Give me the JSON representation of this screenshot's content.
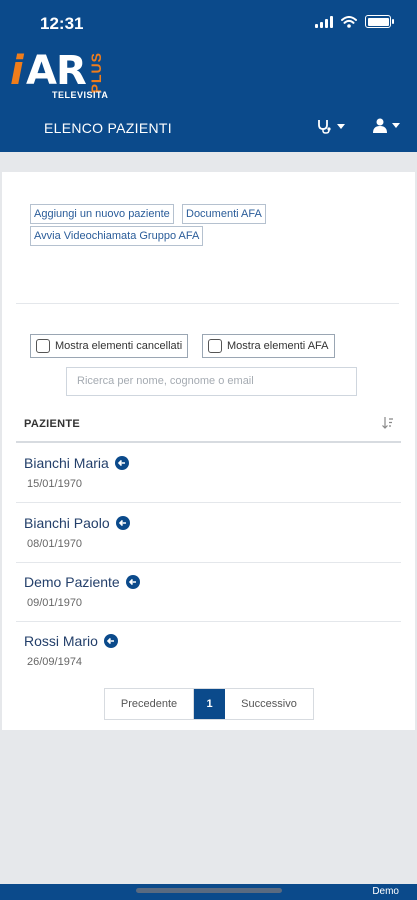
{
  "status_bar": {
    "time": "12:31"
  },
  "logo": {
    "i": "i",
    "ar": "AR",
    "plus": "PLUS",
    "subtitle": "TELEVISITA"
  },
  "nav": {
    "title": "ELENCO PAZIENTI"
  },
  "actions": {
    "add_patient": "Aggiungi un nuovo paziente",
    "documents_afa": "Documenti AFA",
    "group_video_call": "Avvia Videochiamata Gruppo AFA"
  },
  "filters": {
    "show_deleted": "Mostra elementi cancellati",
    "show_afa": "Mostra elementi AFA",
    "search_placeholder": "Ricerca per nome, cognome o email"
  },
  "table": {
    "header": "PAZIENTE",
    "rows": [
      {
        "name": "Bianchi Maria",
        "date": "15/01/1970"
      },
      {
        "name": "Bianchi Paolo",
        "date": "08/01/1970"
      },
      {
        "name": "Demo Paziente",
        "date": "09/01/1970"
      },
      {
        "name": "Rossi Mario",
        "date": "26/09/1974"
      }
    ]
  },
  "pagination": {
    "prev": "Precedente",
    "current": "1",
    "next": "Successivo"
  },
  "footer": {
    "label": "Demo"
  },
  "colors": {
    "primary": "#0b4a8b",
    "accent": "#f07d1b"
  },
  "icons": [
    "wifi-icon",
    "battery-icon",
    "stethoscope-icon",
    "user-icon",
    "sort-icon",
    "arrow-left-circle-icon"
  ]
}
